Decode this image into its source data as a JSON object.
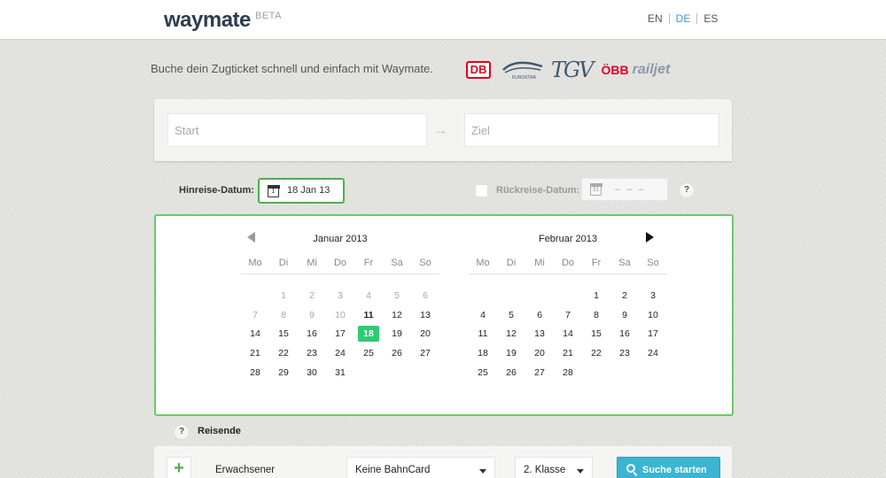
{
  "header": {
    "logo": "waymate",
    "badge": "BETA",
    "languages": [
      {
        "code": "EN",
        "active": false
      },
      {
        "code": "DE",
        "active": true
      },
      {
        "code": "ES",
        "active": false
      }
    ]
  },
  "intro": {
    "tagline": "Buche dein Zugticket schnell und einfach mit Waymate.",
    "operators": {
      "db": "DB",
      "eurostar": "EUROSTAR",
      "tgv": "TGV",
      "obb": "ÖBB",
      "railjet": "railjet"
    }
  },
  "search": {
    "start_placeholder": "Start",
    "ziel_placeholder": "Ziel",
    "arrow": "→"
  },
  "dates": {
    "hinreise_label": "Hinreise-Datum:",
    "hinreise_value": "18 Jan 13",
    "hinreise_icon_num": "1",
    "rueckreise_label": "Rückreise-Datum:",
    "rueckreise_value": "– – –",
    "rueckreise_icon_num": "31",
    "help": "?"
  },
  "calendar": {
    "weekdays": [
      "Mo",
      "Di",
      "Mi",
      "Do",
      "Fr",
      "Sa",
      "So"
    ],
    "months": [
      {
        "title": "Januar 2013",
        "weeks": [
          [
            "",
            "1",
            "2",
            "3",
            "4",
            "5",
            "6"
          ],
          [
            "7",
            "8",
            "9",
            "10",
            "11",
            "12",
            "13"
          ],
          [
            "14",
            "15",
            "16",
            "17",
            "18",
            "19",
            "20"
          ],
          [
            "21",
            "22",
            "23",
            "24",
            "25",
            "26",
            "27"
          ],
          [
            "28",
            "29",
            "30",
            "31",
            "",
            "",
            ""
          ]
        ],
        "past_until": "10",
        "today": "11",
        "selected": "18"
      },
      {
        "title": "Februar 2013",
        "weeks": [
          [
            "",
            "",
            "",
            "",
            "1",
            "2",
            "3"
          ],
          [
            "4",
            "5",
            "6",
            "7",
            "8",
            "9",
            "10"
          ],
          [
            "11",
            "12",
            "13",
            "14",
            "15",
            "16",
            "17"
          ],
          [
            "18",
            "19",
            "20",
            "21",
            "22",
            "23",
            "24"
          ],
          [
            "25",
            "26",
            "27",
            "28",
            "",
            "",
            ""
          ]
        ]
      }
    ]
  },
  "travellers": {
    "label": "Reisende",
    "help": "?",
    "add": "+",
    "passenger_type": "Erwachsener",
    "bahncard": "Keine BahnCard",
    "klasse": "2. Klasse",
    "search_button": "Suche starten"
  },
  "colors": {
    "accent_green": "#2ecc71",
    "calendar_border": "#6bc96b",
    "search_button": "#3bb5d2",
    "active_language": "#3b9ad6",
    "db_red": "#e3001b"
  }
}
